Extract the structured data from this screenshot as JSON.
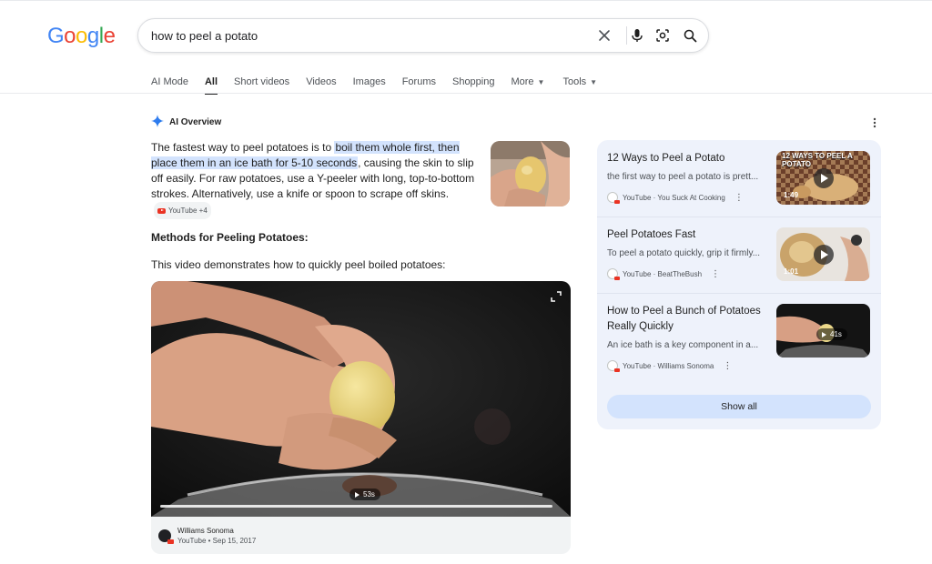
{
  "logo": {
    "text": "Google",
    "letters": [
      "G",
      "o",
      "o",
      "g",
      "l",
      "e"
    ]
  },
  "search": {
    "query": "how to peel a potato",
    "icons": [
      "close-icon",
      "microphone-icon",
      "camera-lens-icon",
      "search-icon"
    ]
  },
  "tabs": [
    {
      "label": "AI Mode"
    },
    {
      "label": "All",
      "active": true
    },
    {
      "label": "Short videos"
    },
    {
      "label": "Videos"
    },
    {
      "label": "Images"
    },
    {
      "label": "Forums"
    },
    {
      "label": "Shopping"
    },
    {
      "label": "More",
      "dropdown": true
    },
    {
      "label": "Tools",
      "dropdown": true
    }
  ],
  "ai_overview": {
    "title": "AI Overview",
    "answer_pre": "The fastest way to peel potatoes is to ",
    "answer_highlight": "boil them whole first, then place them in an ice bath for 5-10 seconds",
    "answer_post": ", causing the skin to slip off easily. For raw potatoes, use a Y-peeler with long, top-to-bottom strokes. Alternatively, use a knife or spoon to scrape off skins.",
    "source_chip": "YouTube +4",
    "methods_heading": "Methods for Peeling Potatoes:",
    "video_intro": "This video demonstrates how to quickly peel boiled potatoes:",
    "video": {
      "duration": "53s",
      "channel": "Williams Sonoma",
      "meta": "YouTube • Sep 15, 2017"
    }
  },
  "related_videos": [
    {
      "title": "12 Ways to Peel a Potato",
      "snippet": "the first way to peel a potato is prett...",
      "source": "YouTube · You Suck At Cooking",
      "duration": "1:49",
      "thumb_text": "12 WAYS TO PEEL A POTATO"
    },
    {
      "title": "Peel Potatoes Fast",
      "snippet": "To peel a potato quickly, grip it firmly...",
      "source": "YouTube · BeatTheBush",
      "duration": "1:01"
    },
    {
      "title": "How to Peel a Bunch of Potatoes Really Quickly",
      "snippet": "An ice bath is a key component in a...",
      "source": "YouTube · Williams Sonoma",
      "duration": "41s"
    }
  ],
  "show_all_label": "Show all",
  "colors": {
    "google_blue": "#4285f4",
    "google_red": "#ea4335",
    "google_yellow": "#fbbc05",
    "google_green": "#34a853",
    "highlight": "#d3e3fd",
    "panel_bg": "#eef2fb",
    "youtube_red": "#ea3323"
  }
}
